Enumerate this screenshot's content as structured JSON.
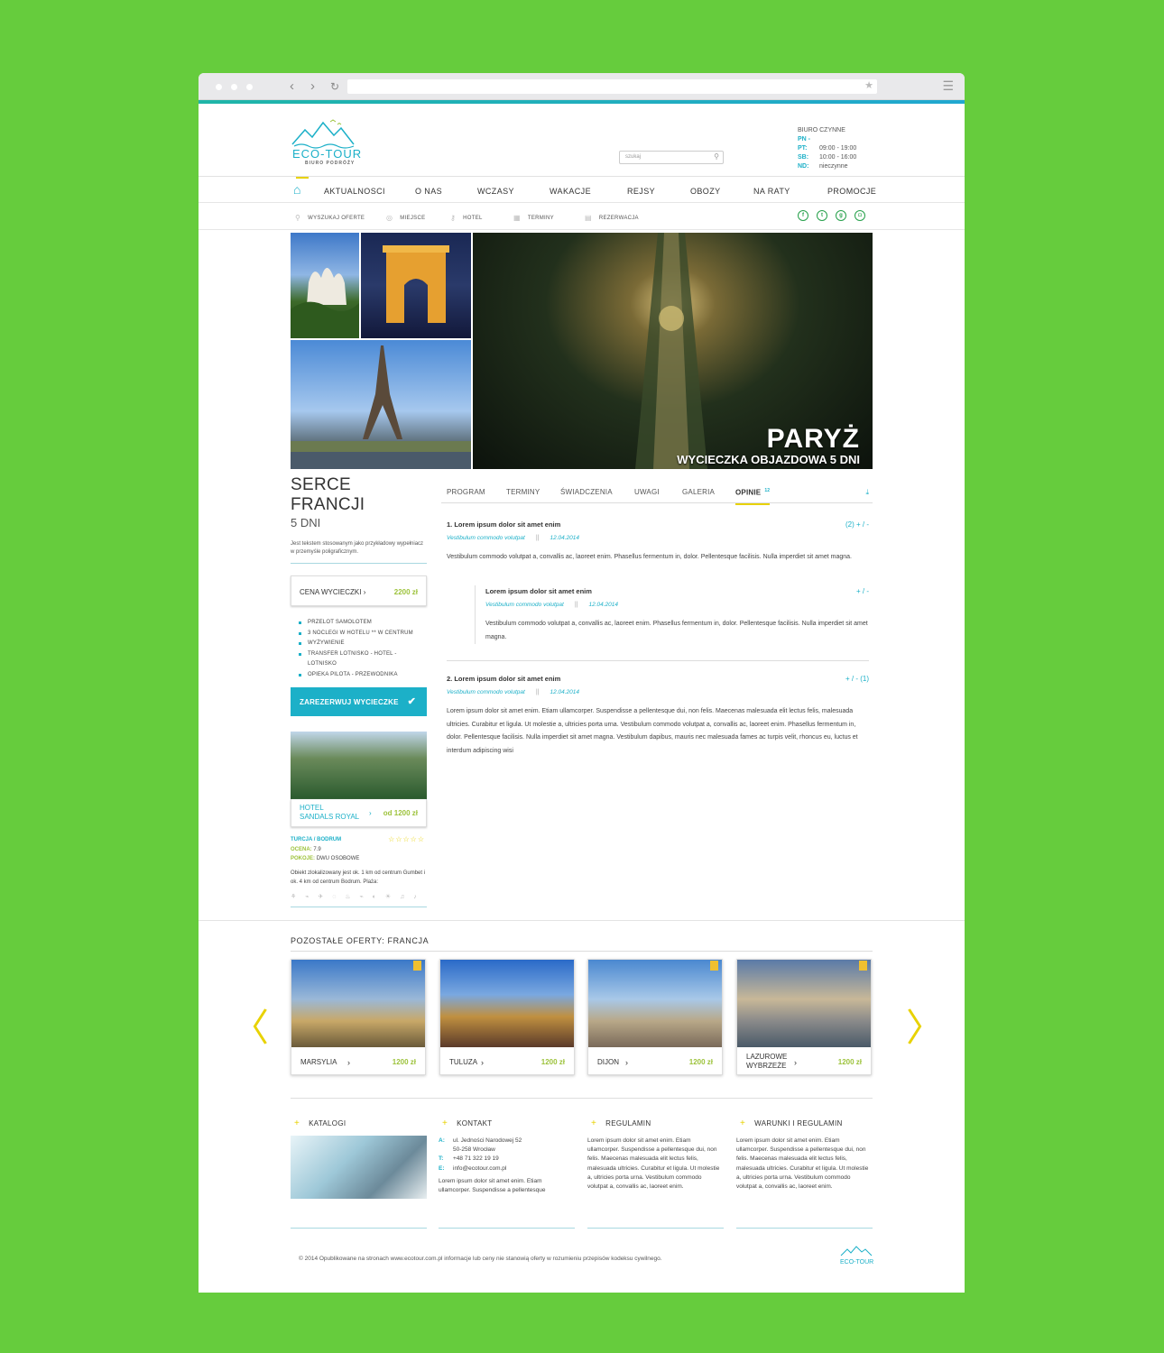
{
  "browser": {
    "url": ""
  },
  "header": {
    "logo_name": "ECO-TOUR",
    "logo_sub": "BIURO PODRÓŻY",
    "search_placeholder": "szukaj",
    "hours_title": "BIURO CZYNNE",
    "hours": [
      {
        "day": "PN - PT:",
        "time": "09:00 - 19:00"
      },
      {
        "day": "SB:",
        "time": "10:00 - 16:00"
      },
      {
        "day": "ND:",
        "time": "nieczynne"
      }
    ]
  },
  "nav": [
    "AKTUALNOSCI",
    "O NAS",
    "WCZASY",
    "WAKACJE",
    "REJSY",
    "OBOZY",
    "NA RATY",
    "PROMOCJE"
  ],
  "subnav": [
    "WYSZUKAJ OFERTE",
    "MIEJSCE",
    "HOTEL",
    "TERMINY",
    "REZERWACJA"
  ],
  "hero": {
    "city": "PARYŻ",
    "sub": "WYCIECZKA OBJAZDOWA 5 DNI"
  },
  "trip": {
    "title": "SERCE FRANCJI",
    "days": "5 DNI",
    "desc": "Jest tekstem stosowanym jako przykładowy wypełniacz w przemyśle poligraficznym.",
    "price_label": "CENA WYCIECZKI",
    "price": "2200 zł",
    "includes": [
      "PRZELOT SAMOLOTEM",
      "3 NOCLEGI W HOTELU ** W CENTRUM",
      "WYŻYWIENIE",
      "TRANSFER LOTNISKO - HOTEL - LOTNISKO",
      "OPIEKA PILOTA - PRZEWODNIKA"
    ],
    "reserve": "ZAREZERWUJ WYCIECZKE"
  },
  "hotel": {
    "name1": "HOTEL",
    "name2": "SANDALS ROYAL",
    "price": "od 1200 zł",
    "location": "TURCJA / BODRUM",
    "rating_label": "OCENA:",
    "rating": "7.9",
    "rooms_label": "POKOJE:",
    "rooms": "DWU OSOBOWE",
    "desc": "Obiekt zlokalizowany jest ok. 1 km od centrum Gumbet i ok. 4 km od centrum Bodrum. Plaża:"
  },
  "tabs": {
    "items": [
      "PROGRAM",
      "TERMINY",
      "ŚWIADCZENIA",
      "UWAGI",
      "GALERIA",
      "OPINIE"
    ],
    "count": "12"
  },
  "reviews": [
    {
      "title": "1. Lorem ipsum dolor sit amet enim",
      "author": "Vestibulum commodo volutpat",
      "date": "12.04.2014",
      "vote": "(2) + / -",
      "text": "Vestibulum commodo volutpat a, convallis ac, laoreet enim. Phasellus fermentum in, dolor. Pellentesque facilisis. Nulla imperdiet sit amet magna."
    },
    {
      "title": "2. Lorem ipsum dolor sit amet enim",
      "author": "Vestibulum commodo volutpat",
      "date": "12.04.2014",
      "vote": "+ / - (1)",
      "text": "Lorem ipsum dolor sit amet enim. Etiam ullamcorper. Suspendisse a pellentesque dui, non felis. Maecenas malesuada elit lectus felis, malesuada ultricies. Curabitur et ligula. Ut molestie a, ultricies porta urna. Vestibulum commodo volutpat a, convallis ac, laoreet enim. Phasellus fermentum in, dolor. Pellentesque facilisis. Nulla imperdiet sit amet magna. Vestibulum dapibus, mauris nec malesuada fames ac turpis velit, rhoncus eu, luctus et interdum adipiscing wisi"
    }
  ],
  "reply": {
    "title": "Lorem ipsum dolor sit amet enim",
    "author": "Vestibulum commodo volutpat",
    "date": "12.04.2014",
    "vote": "+ / -",
    "text": "Vestibulum commodo volutpat a, convallis ac, laoreet enim. Phasellus fermentum in, dolor. Pellentesque facilisis. Nulla imperdiet sit amet magna."
  },
  "offers": {
    "title": "POZOSTAŁE OFERTY: FRANCJA",
    "items": [
      {
        "name": "MARSYLIA",
        "price": "1200 zł"
      },
      {
        "name": "TULUZA",
        "price": "1200 zł"
      },
      {
        "name": "DIJON",
        "price": "1200 zł"
      },
      {
        "name1": "LAZUROWE",
        "name2": "WYBRZEŻE",
        "price": "1200 zł"
      }
    ]
  },
  "footer": {
    "katalogi": "KATALOGI",
    "kontakt": "KONTAKT",
    "contact": [
      {
        "k": "A:",
        "v": "ul. Jedności Narodowej 52"
      },
      {
        "k": "",
        "v": "50-258 Wrocław"
      },
      {
        "k": "T:",
        "v": "+48 71 322 19 19"
      },
      {
        "k": "E:",
        "v": "info@ecotour.com.pl"
      }
    ],
    "contact_text": "Lorem ipsum dolor sit amet enim. Etiam ullamcorper. Suspendisse a pellentesque",
    "regulamin": "REGULAMIN",
    "regulamin_text": "Lorem ipsum dolor sit amet enim. Etiam ullamcorper. Suspendisse a pellentesque dui, non felis. Maecenas malesuada elit lectus felis, malesuada ultricies. Curabitur et ligula. Ut molestie a, ultricies porta urna. Vestibulum commodo volutpat a, convallis ac, laoreet enim.",
    "warunki": "WARUNKI I REGULAMIN",
    "warunki_text": "Lorem ipsum dolor sit amet enim. Etiam ullamcorper. Suspendisse a pellentesque dui, non felis. Maecenas malesuada elit lectus felis, malesuada ultricies. Curabitur et ligula. Ut molestie a, ultricies porta urna. Vestibulum commodo volutpat a, convallis ac, laoreet enim.",
    "copyright": "© 2014   Opublikowane na stronach www.ecotour.com.pl informacje lub ceny nie stanowią oferty w rozumieniu przepisów kodeksu cywilnego.",
    "logo": "ECO-TOUR"
  },
  "colors": {
    "accent": "#1cb0c8",
    "price": "#9cc23a",
    "highlight": "#e8d200",
    "background": "#66cc3d"
  }
}
